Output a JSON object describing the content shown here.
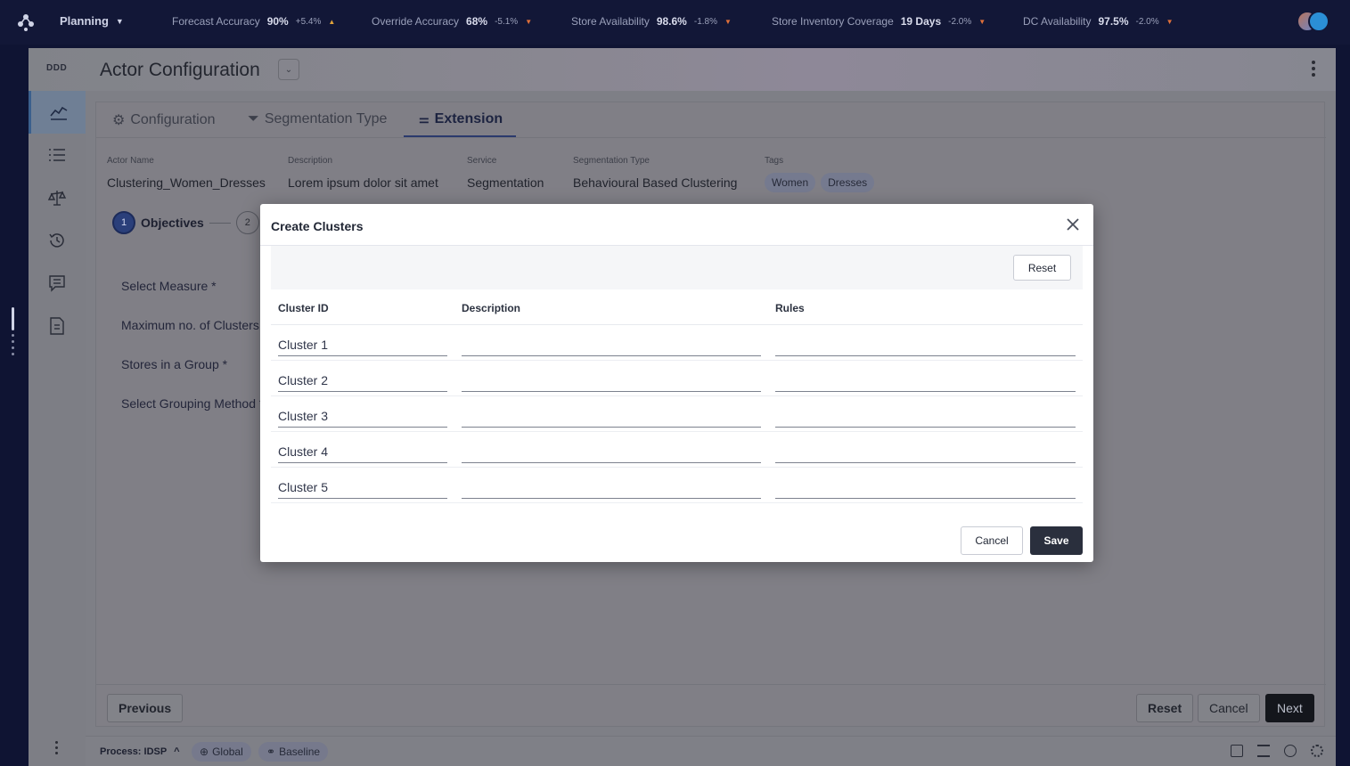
{
  "topbar": {
    "app_switch": "Planning",
    "kpis": [
      {
        "label": "Forecast Accuracy",
        "value": "90%",
        "change": "+5.4%",
        "dir": "up"
      },
      {
        "label": "Override Accuracy",
        "value": "68%",
        "change": "-5.1%",
        "dir": "down"
      },
      {
        "label": "Store Availability",
        "value": "98.6%",
        "change": "-1.8%",
        "dir": "down"
      },
      {
        "label": "Store Inventory Coverage",
        "value": "19 Days",
        "change": "-2.0%",
        "dir": "down"
      },
      {
        "label": "DC Availability",
        "value": "97.5%",
        "change": "-2.0%",
        "dir": "down"
      }
    ]
  },
  "header": {
    "code": "DDD",
    "title": "Actor Configuration"
  },
  "tabs": [
    "Configuration",
    "Segmentation Type",
    "Extension"
  ],
  "meta": [
    {
      "label": "Actor Name",
      "value": "Clustering_Women_Dresses"
    },
    {
      "label": "Description",
      "value": "Lorem ipsum dolor sit amet"
    },
    {
      "label": "Service",
      "value": "Segmentation"
    },
    {
      "label": "Segmentation Type",
      "value": "Behavioural Based Clustering"
    }
  ],
  "tags_label": "Tags",
  "tags": [
    "Women",
    "Dresses"
  ],
  "stepper": {
    "step1_num": "1",
    "step1_label": "Objectives",
    "step2_num": "2"
  },
  "form_labels": [
    "Select Measure *",
    "Maximum no. of Clusters",
    "Stores in a Group *",
    "Select Grouping Method *"
  ],
  "footer": {
    "previous": "Previous",
    "reset": "Reset",
    "cancel": "Cancel",
    "next": "Next"
  },
  "statusbar": {
    "process": "Process: IDSP",
    "chip_global": "Global",
    "chip_baseline": "Baseline"
  },
  "modal": {
    "title": "Create Clusters",
    "reset": "Reset",
    "columns": [
      "Cluster ID",
      "Description",
      "Rules"
    ],
    "rows": [
      {
        "id": "Cluster 1",
        "description": "",
        "rules": ""
      },
      {
        "id": "Cluster 2",
        "description": "",
        "rules": ""
      },
      {
        "id": "Cluster 3",
        "description": "",
        "rules": ""
      },
      {
        "id": "Cluster 4",
        "description": "",
        "rules": ""
      },
      {
        "id": "Cluster 5",
        "description": "",
        "rules": ""
      }
    ],
    "cancel": "Cancel",
    "save": "Save"
  }
}
